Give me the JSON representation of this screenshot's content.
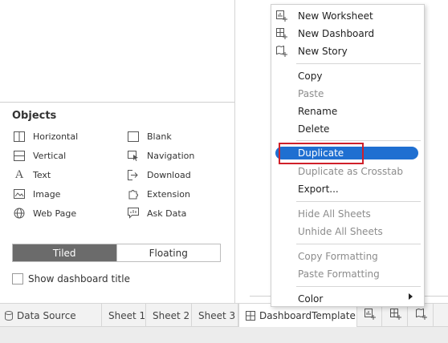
{
  "left_panel": {
    "objects_title": "Objects",
    "objects": [
      {
        "label": "Horizontal",
        "icon": "horizontal-layout-icon"
      },
      {
        "label": "Blank",
        "icon": "blank-icon"
      },
      {
        "label": "Vertical",
        "icon": "vertical-layout-icon"
      },
      {
        "label": "Navigation",
        "icon": "navigation-icon"
      },
      {
        "label": "Text",
        "icon": "text-icon"
      },
      {
        "label": "Download",
        "icon": "download-icon"
      },
      {
        "label": "Image",
        "icon": "image-icon"
      },
      {
        "label": "Extension",
        "icon": "extension-icon"
      },
      {
        "label": "Web Page",
        "icon": "web-page-icon"
      },
      {
        "label": "Ask Data",
        "icon": "ask-data-icon"
      }
    ],
    "layout_toggle": {
      "tiled": "Tiled",
      "floating": "Floating",
      "selected": "Tiled"
    },
    "show_title_label": "Show dashboard title",
    "show_title_checked": false
  },
  "tabs": {
    "data_source": "Data Source",
    "sheets": [
      "Sheet 1",
      "Sheet 2",
      "Sheet 3"
    ],
    "active_tab": "DashboardTemplate"
  },
  "context_menu": {
    "items": [
      {
        "label": "New Worksheet",
        "icon": "new-worksheet-icon",
        "enabled": true
      },
      {
        "label": "New Dashboard",
        "icon": "new-dashboard-icon",
        "enabled": true
      },
      {
        "label": "New Story",
        "icon": "new-story-icon",
        "enabled": true
      },
      {
        "label": "Copy",
        "enabled": true
      },
      {
        "label": "Paste",
        "enabled": false
      },
      {
        "label": "Rename",
        "enabled": true
      },
      {
        "label": "Delete",
        "enabled": true
      },
      {
        "label": "Duplicate",
        "enabled": true,
        "highlighted": true
      },
      {
        "label": "Duplicate as Crosstab",
        "enabled": false
      },
      {
        "label": "Export...",
        "enabled": true
      },
      {
        "label": "Hide All Sheets",
        "enabled": false
      },
      {
        "label": "Unhide All Sheets",
        "enabled": false
      },
      {
        "label": "Copy Formatting",
        "enabled": false
      },
      {
        "label": "Paste Formatting",
        "enabled": false
      },
      {
        "label": "Color",
        "enabled": true,
        "has_submenu": true
      }
    ]
  },
  "colors": {
    "highlight": "#1f6fd1",
    "callout_border": "#d0202a",
    "toggle_active": "#6b6b6b"
  }
}
